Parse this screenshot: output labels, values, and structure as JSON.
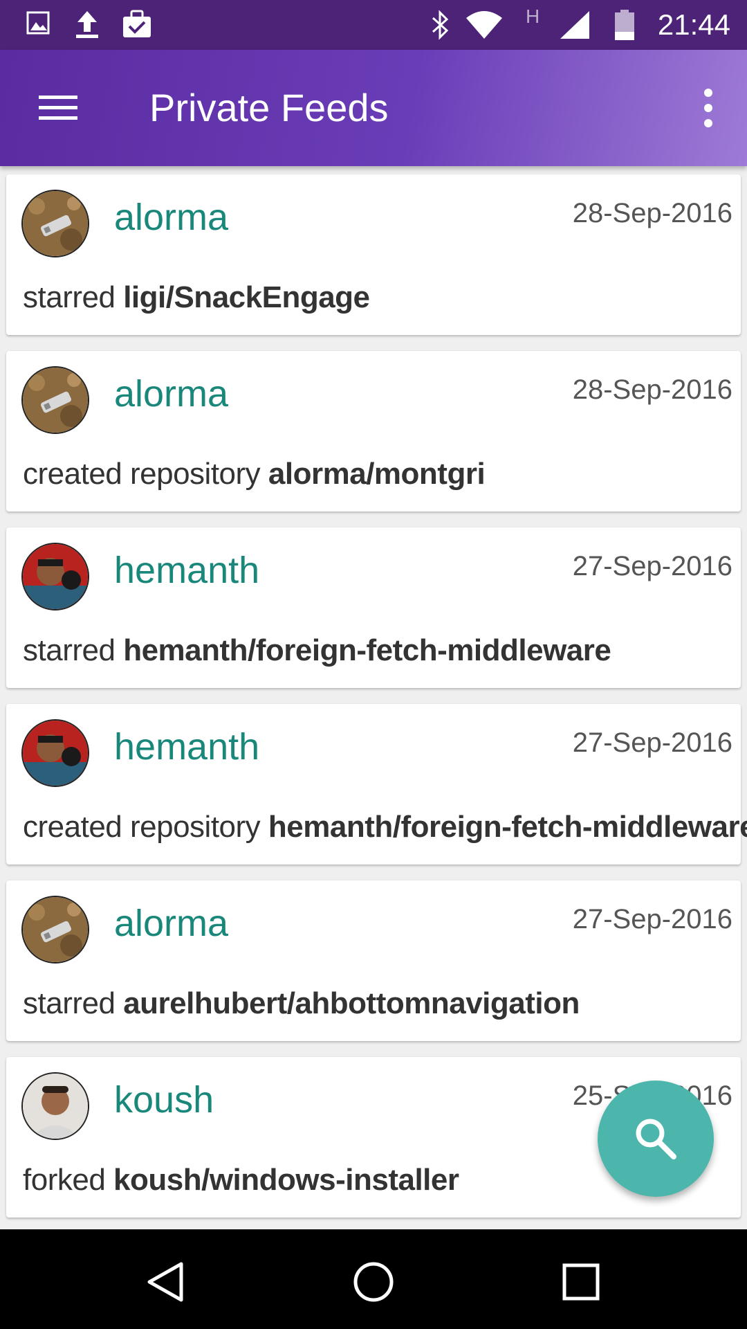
{
  "status_bar": {
    "time": "21:44",
    "left_icons": [
      "image-icon",
      "upload-icon",
      "clipboard-check-icon"
    ],
    "right_icons": [
      "bluetooth-icon",
      "wifi-icon",
      "h-network-icon",
      "cell-signal-icon",
      "battery-icon"
    ],
    "network_letter": "H"
  },
  "app_bar": {
    "title": "Private Feeds"
  },
  "feeds": [
    {
      "user": "alorma",
      "date": "28-Sep-2016",
      "action": "starred",
      "repo": "ligi/SnackEngage",
      "avatar": "alorma"
    },
    {
      "user": "alorma",
      "date": "28-Sep-2016",
      "action": "created repository",
      "repo": "alorma/montgri",
      "avatar": "alorma"
    },
    {
      "user": "hemanth",
      "date": "27-Sep-2016",
      "action": "starred",
      "repo": "hemanth/foreign-fetch-middleware",
      "avatar": "hemanth"
    },
    {
      "user": "hemanth",
      "date": "27-Sep-2016",
      "action": "created repository",
      "repo": "hemanth/foreign-fetch-middleware",
      "avatar": "hemanth"
    },
    {
      "user": "alorma",
      "date": "27-Sep-2016",
      "action": "starred",
      "repo": "aurelhubert/ahbottomnavigation",
      "avatar": "alorma"
    },
    {
      "user": "koush",
      "date": "25-Sep-2016",
      "action": "forked",
      "repo": "koush/windows-installer",
      "avatar": "koush"
    }
  ],
  "colors": {
    "status_bar": "#4c2377",
    "app_bar": "#5a2ca0",
    "username": "#19877a",
    "fab": "#4db6ac"
  }
}
